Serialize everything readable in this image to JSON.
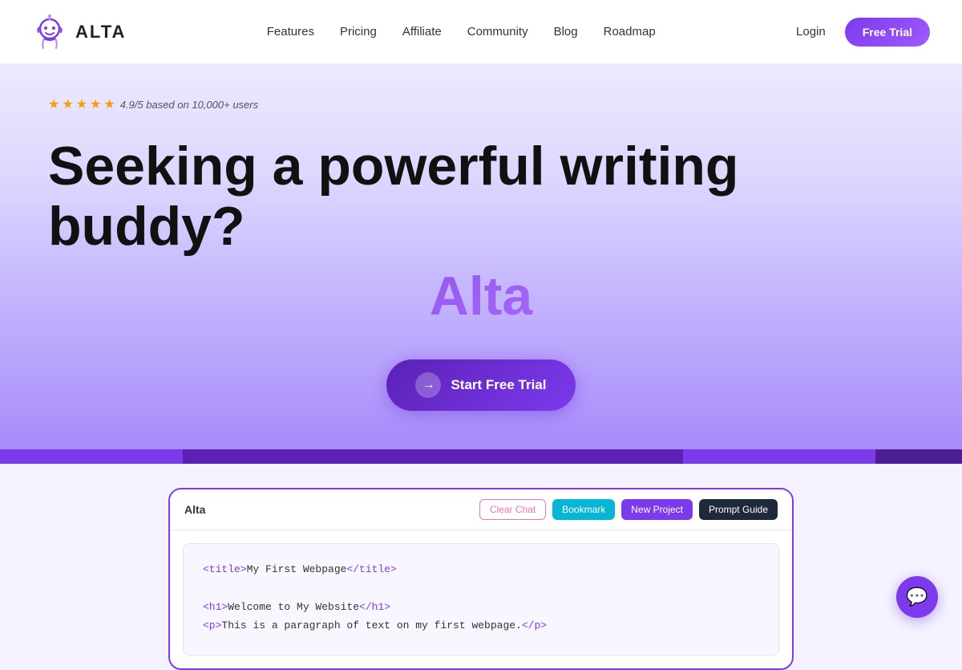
{
  "nav": {
    "logo_text": "ALTA",
    "links": [
      {
        "label": "Features",
        "id": "features"
      },
      {
        "label": "Pricing",
        "id": "pricing"
      },
      {
        "label": "Affiliate",
        "id": "affiliate"
      },
      {
        "label": "Community",
        "id": "community"
      },
      {
        "label": "Blog",
        "id": "blog"
      },
      {
        "label": "Roadmap",
        "id": "roadmap"
      }
    ],
    "login_label": "Login",
    "free_trial_label": "Free Trial"
  },
  "hero": {
    "rating_text": "4.9/5 based on 10,000+ users",
    "heading": "Seeking a powerful writing buddy?",
    "brand": "Alta",
    "cta_label": "Start Free Trial"
  },
  "app_preview": {
    "title": "Alta",
    "btn_clear": "Clear Chat",
    "btn_bookmark": "Bookmark",
    "btn_new_project": "New Project",
    "btn_prompt_guide": "Prompt Guide",
    "code_line1": "<title>My First Webpage</title>",
    "code_line2": "<h1>Welcome to My Website</h1>",
    "code_line3": "<p>This is a paragraph of text on my first webpage.</p>"
  },
  "colors": {
    "brand_purple": "#7c3aed",
    "brand_light": "#c084fc",
    "star_color": "#f59e0b"
  }
}
